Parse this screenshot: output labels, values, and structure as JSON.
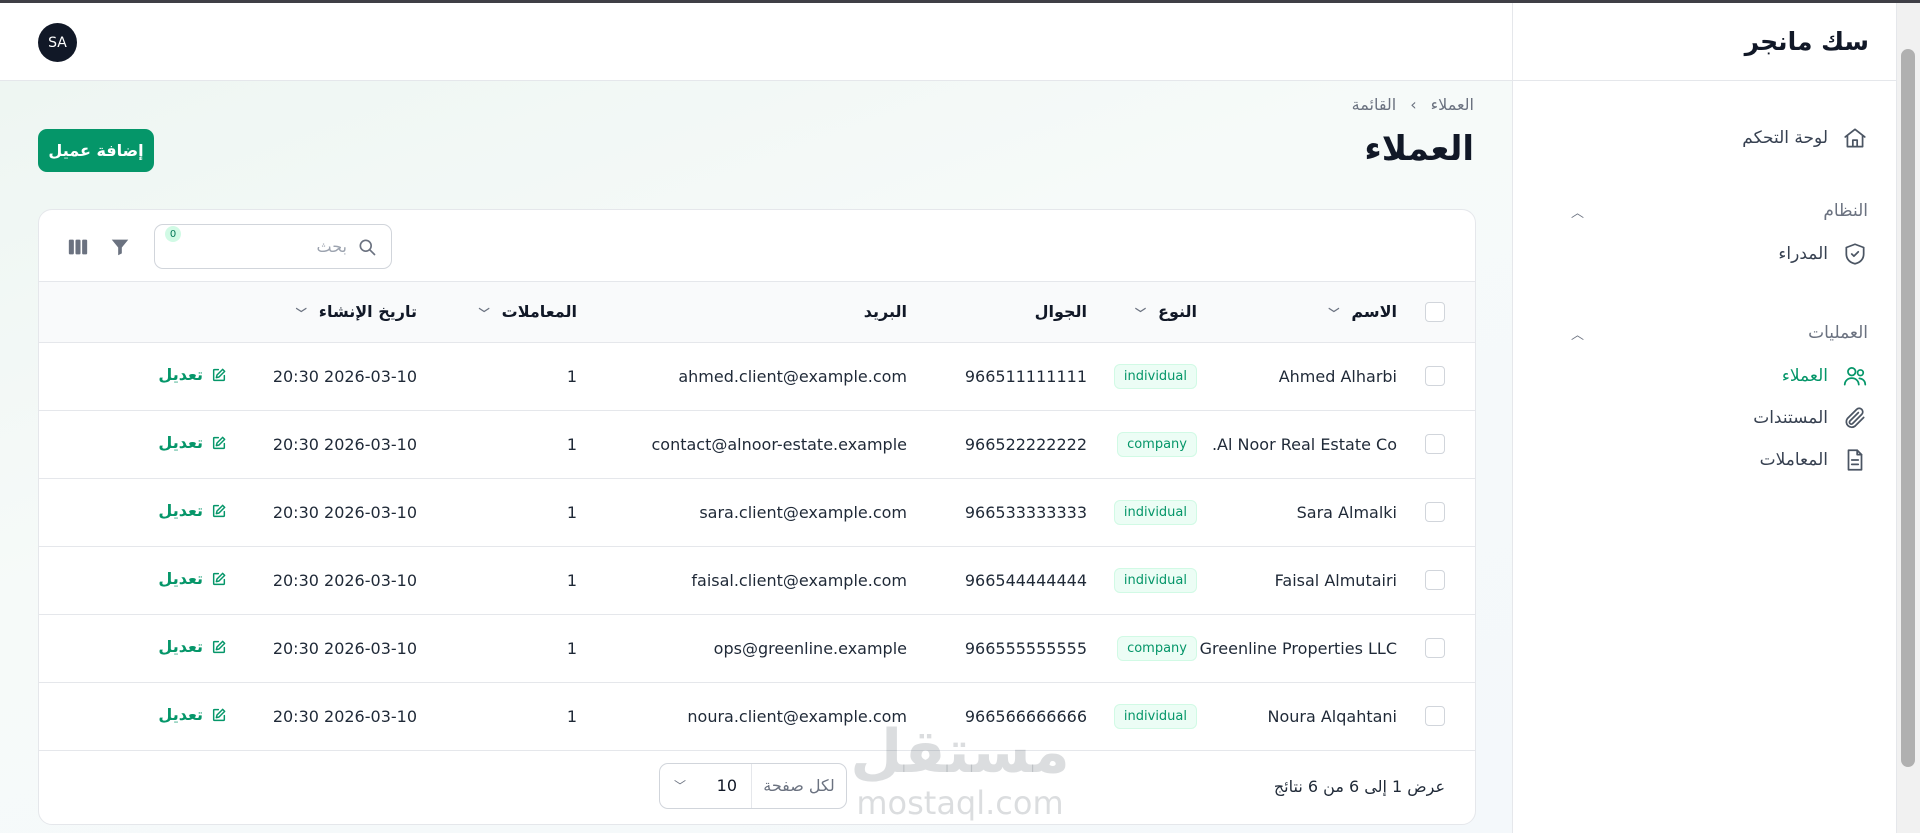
{
  "app": {
    "title": "سك مانجر"
  },
  "user": {
    "initials": "SA"
  },
  "sidebar": {
    "dashboard": "لوحة التحكم",
    "system_group": "النظام",
    "admins": "المدراء",
    "operations_group": "العمليات",
    "clients": "العملاء",
    "documents": "المستندات",
    "transactions": "المعاملات"
  },
  "breadcrumb": {
    "parent": "العملاء",
    "current": "القائمة",
    "separator": "›"
  },
  "page": {
    "title": "العملاء",
    "add_button": "إضافة عميل"
  },
  "toolbar": {
    "search_placeholder": "بحث",
    "filter_count": "0"
  },
  "table": {
    "headers": {
      "name": "الاسم",
      "type": "النوع",
      "phone": "الجوال",
      "email": "البريد",
      "transactions": "المعاملات",
      "created_at": "تاريخ الإنشاء"
    },
    "edit_label": "تعديل",
    "rows": [
      {
        "name": "Ahmed Alharbi",
        "type": "individual",
        "phone": "966511111111",
        "email": "ahmed.client@example.com",
        "transactions": "1",
        "created_at": "2026-03-10 20:30"
      },
      {
        "name": "Al Noor Real Estate Co.",
        "type": "company",
        "phone": "966522222222",
        "email": "contact@alnoor-estate.example",
        "transactions": "1",
        "created_at": "2026-03-10 20:30"
      },
      {
        "name": "Sara Almalki",
        "type": "individual",
        "phone": "966533333333",
        "email": "sara.client@example.com",
        "transactions": "1",
        "created_at": "2026-03-10 20:30"
      },
      {
        "name": "Faisal Almutairi",
        "type": "individual",
        "phone": "966544444444",
        "email": "faisal.client@example.com",
        "transactions": "1",
        "created_at": "2026-03-10 20:30"
      },
      {
        "name": "Greenline Properties LLC",
        "type": "company",
        "phone": "966555555555",
        "email": "ops@greenline.example",
        "transactions": "1",
        "created_at": "2026-03-10 20:30"
      },
      {
        "name": "Noura Alqahtani",
        "type": "individual",
        "phone": "966566666666",
        "email": "noura.client@example.com",
        "transactions": "1",
        "created_at": "2026-03-10 20:30"
      }
    ]
  },
  "pagination": {
    "summary": "عرض 1 إلى 6 من 6 نتائج",
    "per_page_label": "لكل صفحة",
    "per_page_value": "10"
  },
  "watermark": {
    "arabic": "مستقل",
    "latin": "mostaql.com"
  },
  "colors": {
    "accent": "#059669",
    "badge_bg": "#ecfdf5"
  }
}
